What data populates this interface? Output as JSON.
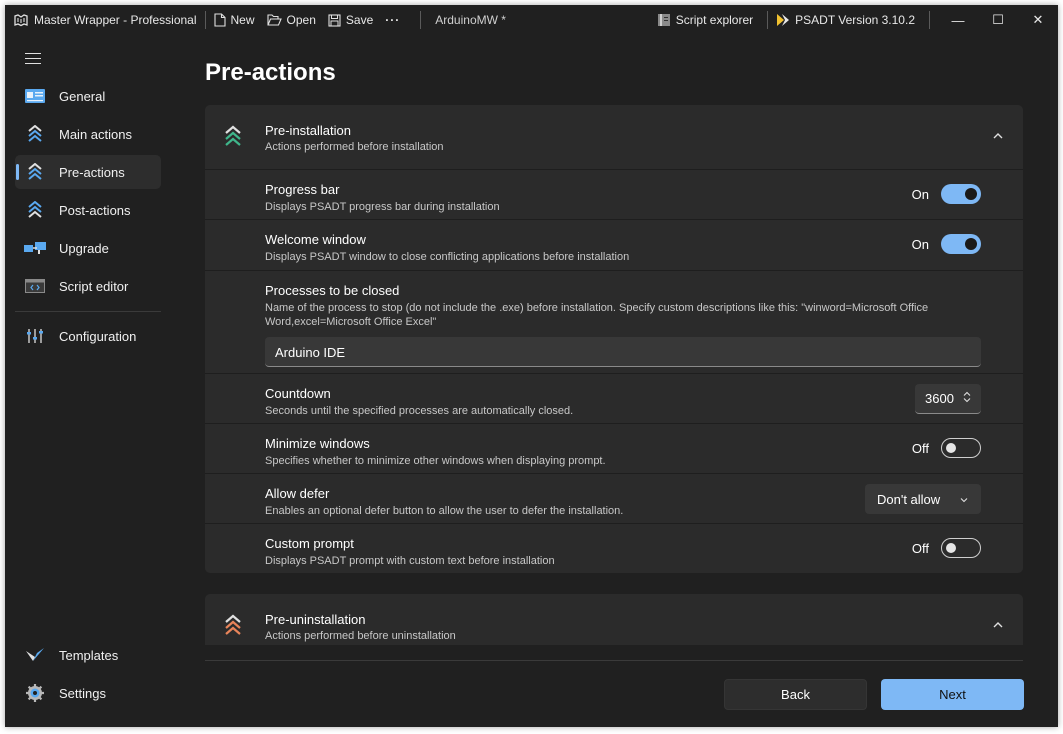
{
  "titlebar": {
    "app_name": "Master Wrapper - Professional",
    "new_label": "New",
    "open_label": "Open",
    "save_label": "Save",
    "more_label": "···",
    "project_name": "ArduinoMW *",
    "script_explorer_label": "Script explorer",
    "psadt_version_label": "PSADT Version  3.10.2",
    "minimize_label": "—",
    "maximize_label": "☐",
    "close_label": "✕"
  },
  "sidebar": {
    "items": [
      {
        "label": "General",
        "icon": "general-icon"
      },
      {
        "label": "Main actions",
        "icon": "chevrons-up-icon"
      },
      {
        "label": "Pre-actions",
        "icon": "chevrons-up-icon",
        "active": true
      },
      {
        "label": "Post-actions",
        "icon": "chevrons-up-icon"
      },
      {
        "label": "Upgrade",
        "icon": "upgrade-icon"
      },
      {
        "label": "Script editor",
        "icon": "code-icon"
      },
      {
        "label": "Configuration",
        "icon": "sliders-icon"
      }
    ],
    "bottom_items": [
      {
        "label": "Templates",
        "icon": "templates-icon"
      },
      {
        "label": "Settings",
        "icon": "gear-icon"
      }
    ]
  },
  "page": {
    "title": "Pre-actions"
  },
  "pre_installation": {
    "title": "Pre-installation",
    "subtitle": "Actions performed before installation",
    "rows": {
      "progress_bar": {
        "title": "Progress bar",
        "desc": "Displays PSADT progress bar during installation",
        "state": "On"
      },
      "welcome_window": {
        "title": "Welcome window",
        "desc": "Displays PSADT window to close conflicting applications before installation",
        "state": "On"
      },
      "processes": {
        "title": "Processes to be closed",
        "desc": "Name of the process to stop (do not include the .exe) before installation. Specify custom descriptions like this: \"winword=Microsoft Office Word,excel=Microsoft Office Excel\"",
        "value": "Arduino IDE"
      },
      "countdown": {
        "title": "Countdown",
        "desc": "Seconds until the specified processes are automatically closed.",
        "value": "3600"
      },
      "minimize": {
        "title": "Minimize windows",
        "desc": "Specifies whether to minimize other windows when displaying prompt.",
        "state": "Off"
      },
      "allow_defer": {
        "title": "Allow defer",
        "desc": "Enables an optional defer button to allow the user to defer the installation.",
        "value": "Don't allow"
      },
      "custom_prompt": {
        "title": "Custom prompt",
        "desc": "Displays PSADT prompt with custom text before installation",
        "state": "Off"
      }
    }
  },
  "pre_uninstallation": {
    "title": "Pre-uninstallation",
    "subtitle": "Actions performed before uninstallation"
  },
  "footer": {
    "back_label": "Back",
    "next_label": "Next"
  },
  "colors": {
    "accent": "#7eb8f5",
    "background": "#202020",
    "card": "#2b2b2b",
    "icon_green": "#3fb68b",
    "icon_blue": "#5aa9f0",
    "icon_orange": "#e8845a"
  }
}
